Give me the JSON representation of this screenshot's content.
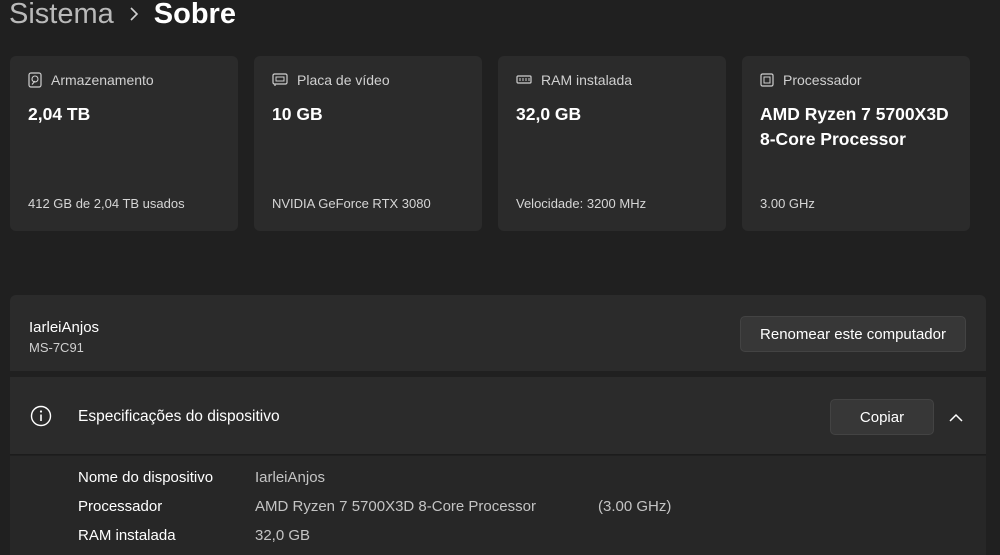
{
  "breadcrumb": {
    "parent": "Sistema",
    "current": "Sobre"
  },
  "cards": [
    {
      "title": "Armazenamento",
      "icon": "storage-icon",
      "value": "2,04 TB",
      "sub": "412 GB de 2,04 TB usados"
    },
    {
      "title": "Placa de vídeo",
      "icon": "gpu-icon",
      "value": "10 GB",
      "sub": "NVIDIA GeForce RTX 3080"
    },
    {
      "title": "RAM instalada",
      "icon": "ram-icon",
      "value": "32,0 GB",
      "sub": "Velocidade: 3200 MHz"
    },
    {
      "title": "Processador",
      "icon": "cpu-icon",
      "value": "AMD Ryzen 7 5700X3D 8-Core Processor",
      "sub": "3.00 GHz"
    }
  ],
  "device": {
    "name": "IarleiAnjos",
    "model": "MS-7C91",
    "rename_label": "Renomear este computador"
  },
  "specs": {
    "title": "Especificações do dispositivo",
    "copy_label": "Copiar",
    "rows": [
      {
        "label": "Nome do dispositivo",
        "value": "IarleiAnjos",
        "extra": ""
      },
      {
        "label": "Processador",
        "value": "AMD Ryzen 7 5700X3D 8-Core Processor",
        "extra": "(3.00 GHz)"
      },
      {
        "label": "RAM instalada",
        "value": "32,0 GB",
        "extra": ""
      }
    ]
  }
}
